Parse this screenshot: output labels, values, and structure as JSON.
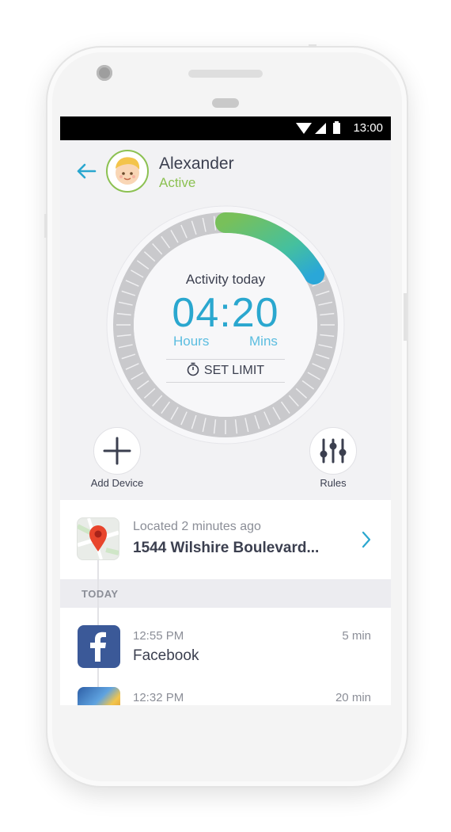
{
  "status_bar": {
    "time": "13:00"
  },
  "profile": {
    "name": "Alexander",
    "status": "Active"
  },
  "activity": {
    "title": "Activity today",
    "time": "04:20",
    "hours_label": "Hours",
    "mins_label": "Mins",
    "set_limit_label": "SET LIMIT"
  },
  "actions": {
    "add_device_label": "Add Device",
    "rules_label": "Rules"
  },
  "location": {
    "subtitle": "Located 2 minutes ago",
    "address": "1544 Wilshire Boulevard..."
  },
  "timeline": {
    "section_label": "TODAY",
    "items": [
      {
        "time": "12:55 PM",
        "app": "Facebook",
        "duration": "5 min",
        "icon": "facebook-icon"
      },
      {
        "time": "12:32 PM",
        "app": "",
        "duration": "20 min",
        "icon": "game-app-icon"
      }
    ]
  },
  "colors": {
    "accent": "#2aa7cf",
    "active_green": "#8cc152",
    "text_dark": "#3b3f4f"
  }
}
